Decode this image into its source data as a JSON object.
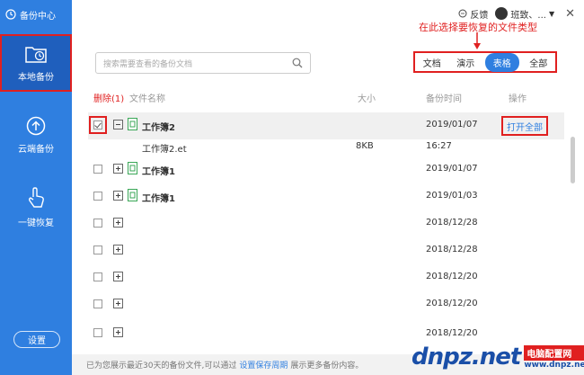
{
  "sidebar": {
    "brand": "备份中心",
    "items": [
      {
        "label": "本地备份",
        "icon": "folder-clock-icon"
      },
      {
        "label": "云端备份",
        "icon": "cloud-upload-icon"
      },
      {
        "label": "一键恢复",
        "icon": "hand-pointer-icon"
      }
    ],
    "settings_label": "设置"
  },
  "topbar": {
    "feedback_label": "反馈",
    "user_name": "班致、...",
    "close_label": "✕"
  },
  "annotation": {
    "text": "在此选择要恢复的文件类型"
  },
  "search": {
    "placeholder": "搜索需要查看的备份文档"
  },
  "filters": [
    {
      "label": "文档",
      "active": false
    },
    {
      "label": "演示",
      "active": false
    },
    {
      "label": "表格",
      "active": true
    },
    {
      "label": "全部",
      "active": false
    }
  ],
  "table": {
    "headers": {
      "delete": "删除(1)",
      "name": "文件名称",
      "size": "大小",
      "time": "备份时间",
      "action": "操作"
    },
    "rows": [
      {
        "name": "工作簿2",
        "time": "2019/01/07",
        "action": "打开全部",
        "checked": true,
        "expanded": true
      },
      {
        "name": "工作簿2.et",
        "size": "8KB",
        "time": "16:27",
        "child": true
      },
      {
        "name": "工作簿1",
        "time": "2019/01/07"
      },
      {
        "name": "工作簿1",
        "time": "2019/01/03"
      },
      {
        "name": "",
        "time": "2018/12/28"
      },
      {
        "name": "",
        "time": "2018/12/28"
      },
      {
        "name": "",
        "time": "2018/12/20"
      },
      {
        "name": "",
        "time": "2018/12/20"
      },
      {
        "name": "",
        "time": "2018/12/20"
      }
    ]
  },
  "footer": {
    "text_before": "已为您展示最近30天的备份文件,可以通过",
    "link": "设置保存周期",
    "text_after": "展示更多备份内容。"
  },
  "watermark": {
    "logo": "dnpz.net",
    "cn": "电脑配置网",
    "url": "www.dnpz.net"
  },
  "colors": {
    "primary": "#2f7fe0",
    "annotation": "#e02020"
  }
}
